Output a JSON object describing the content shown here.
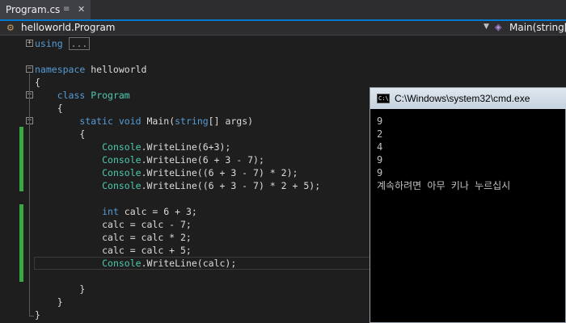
{
  "tab": {
    "title": "Program.cs",
    "pin_icon": "pin-icon",
    "close_icon": "close-icon"
  },
  "navbar": {
    "type_scope": "helloworld.Program",
    "member_scope": "Main(string[]"
  },
  "editor": {
    "lines": [
      {
        "tokens": [
          [
            "kw",
            "using"
          ],
          [
            "",
            " "
          ],
          [
            "box",
            "..."
          ]
        ]
      },
      {
        "tokens": []
      },
      {
        "tokens": [
          [
            "kw",
            "namespace"
          ],
          [
            "",
            " helloworld"
          ]
        ]
      },
      {
        "tokens": [
          [
            "",
            "{"
          ]
        ]
      },
      {
        "tokens": [
          [
            "",
            "    "
          ],
          [
            "kw",
            "class"
          ],
          [
            "",
            " "
          ],
          [
            "ty",
            "Program"
          ]
        ]
      },
      {
        "tokens": [
          [
            "",
            "    {"
          ]
        ]
      },
      {
        "tokens": [
          [
            "",
            "        "
          ],
          [
            "kw",
            "static"
          ],
          [
            "",
            " "
          ],
          [
            "kw",
            "void"
          ],
          [
            "",
            " Main("
          ],
          [
            "kw",
            "string"
          ],
          [
            "",
            "[] args)"
          ]
        ]
      },
      {
        "tokens": [
          [
            "",
            "        {"
          ]
        ]
      },
      {
        "tokens": [
          [
            "",
            "            "
          ],
          [
            "ty",
            "Console"
          ],
          [
            "",
            ".WriteLine(6+3);"
          ]
        ]
      },
      {
        "tokens": [
          [
            "",
            "            "
          ],
          [
            "ty",
            "Console"
          ],
          [
            "",
            ".WriteLine(6 + 3 - 7);"
          ]
        ]
      },
      {
        "tokens": [
          [
            "",
            "            "
          ],
          [
            "ty",
            "Console"
          ],
          [
            "",
            ".WriteLine((6 + 3 - 7) * 2);"
          ]
        ]
      },
      {
        "tokens": [
          [
            "",
            "            "
          ],
          [
            "ty",
            "Console"
          ],
          [
            "",
            ".WriteLine((6 + 3 - 7) * 2 + 5);"
          ]
        ]
      },
      {
        "tokens": []
      },
      {
        "tokens": [
          [
            "",
            "            "
          ],
          [
            "kw",
            "int"
          ],
          [
            "",
            " calc = 6 + 3;"
          ]
        ]
      },
      {
        "tokens": [
          [
            "",
            "            calc = calc - 7;"
          ]
        ]
      },
      {
        "tokens": [
          [
            "",
            "            calc = calc * 2;"
          ]
        ]
      },
      {
        "tokens": [
          [
            "",
            "            calc = calc + 5;"
          ]
        ]
      },
      {
        "tokens": [
          [
            "",
            "            "
          ],
          [
            "ty",
            "Console"
          ],
          [
            "",
            ".WriteLine(calc);"
          ]
        ]
      },
      {
        "tokens": []
      },
      {
        "tokens": [
          [
            "",
            "        }"
          ]
        ]
      },
      {
        "tokens": [
          [
            "",
            "    }"
          ]
        ]
      },
      {
        "tokens": [
          [
            "",
            "}"
          ]
        ]
      }
    ]
  },
  "console": {
    "title": "C:\\Windows\\system32\\cmd.exe",
    "output": [
      "9",
      "2",
      "4",
      "9",
      "9",
      "계속하려면 아무 키나 누르십시"
    ]
  }
}
